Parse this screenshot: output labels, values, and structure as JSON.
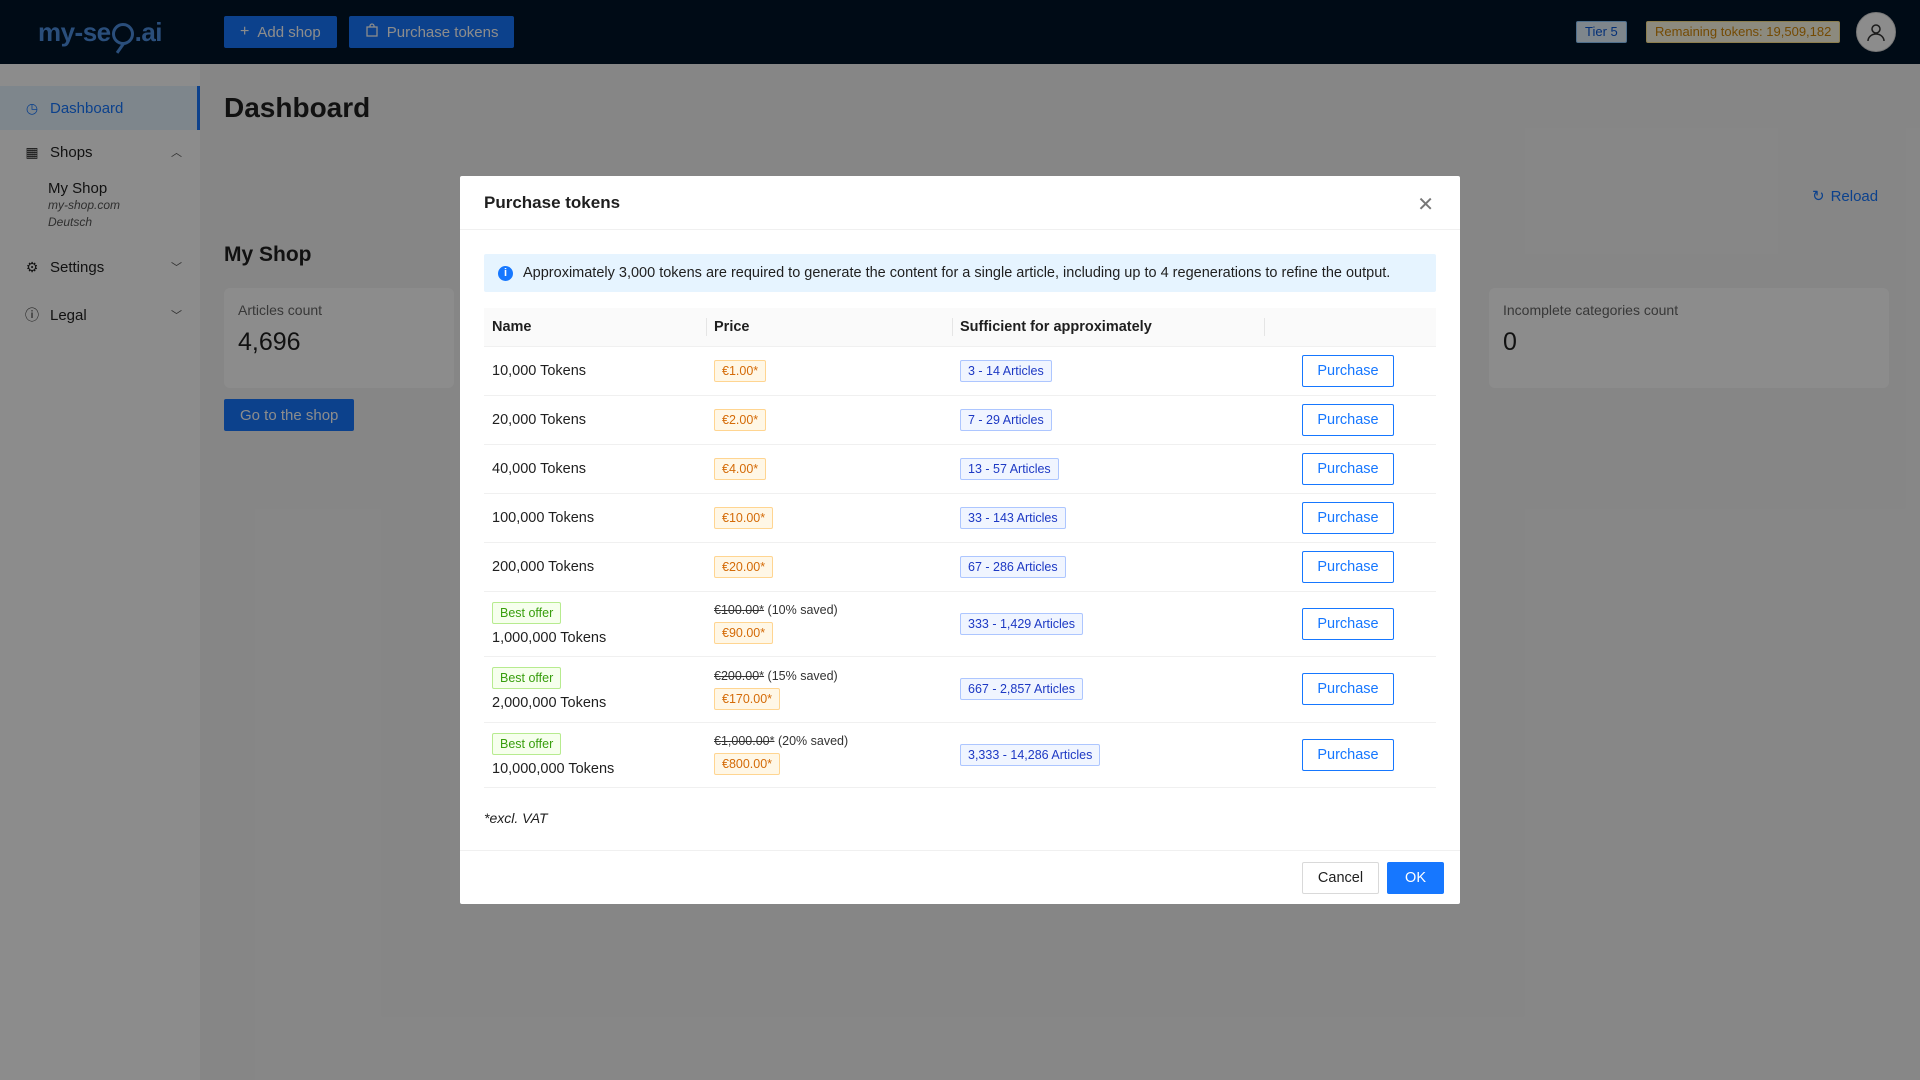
{
  "header": {
    "logo_prefix": "my-se",
    "logo_suffix": ".ai",
    "add_shop_label": "Add shop",
    "purchase_tokens_label": "Purchase tokens",
    "tier": "Tier 5",
    "remaining_tokens": "Remaining tokens: 19,509,182"
  },
  "sidebar": {
    "dashboard": "Dashboard",
    "shops": "Shops",
    "shop_name": "My Shop",
    "shop_domain": "my-shop.com",
    "shop_lang": "Deutsch",
    "settings": "Settings",
    "legal": "Legal"
  },
  "main": {
    "title": "Dashboard",
    "reload": "Reload",
    "shop_title": "My Shop",
    "articles_label": "Articles count",
    "articles_value": "4,696",
    "incomplete_label": "Incomplete categories count",
    "incomplete_value": "0",
    "go_button": "Go to the shop"
  },
  "modal": {
    "title": "Purchase tokens",
    "info": "Approximately 3,000 tokens are required to generate the content for a single article, including up to 4 regenerations to refine the output.",
    "columns": [
      "Name",
      "Price",
      "Sufficient for approximately",
      ""
    ],
    "rows": [
      {
        "name": "10,000 Tokens",
        "price": "€1.00*",
        "articles": "3 - 14 Articles",
        "action": "Purchase"
      },
      {
        "name": "20,000 Tokens",
        "price": "€2.00*",
        "articles": "7 - 29 Articles",
        "action": "Purchase"
      },
      {
        "name": "40,000 Tokens",
        "price": "€4.00*",
        "articles": "13 - 57 Articles",
        "action": "Purchase"
      },
      {
        "name": "100,000 Tokens",
        "price": "€10.00*",
        "articles": "33 - 143 Articles",
        "action": "Purchase"
      },
      {
        "name": "200,000 Tokens",
        "price": "€20.00*",
        "articles": "67 - 286 Articles",
        "action": "Purchase"
      }
    ],
    "best_rows": [
      {
        "badge": "Best offer",
        "name": "1,000,000 Tokens",
        "original": "€100.00*",
        "saved": "(10% saved)",
        "price": "€90.00*",
        "articles": "333 - 1,429 Articles",
        "action": "Purchase"
      },
      {
        "badge": "Best offer",
        "name": "2,000,000 Tokens",
        "original": "€200.00*",
        "saved": "(15% saved)",
        "price": "€170.00*",
        "articles": "667 - 2,857 Articles",
        "action": "Purchase"
      },
      {
        "badge": "Best offer",
        "name": "10,000,000 Tokens",
        "original": "€1,000.00*",
        "saved": "(20% saved)",
        "price": "€800.00*",
        "articles": "3,333 - 14,286 Articles",
        "action": "Purchase"
      }
    ],
    "vat_note": "*excl. VAT",
    "cancel": "Cancel",
    "ok": "OK"
  },
  "colors": {
    "primary": "#1677ff",
    "header_bg": "#001529"
  }
}
